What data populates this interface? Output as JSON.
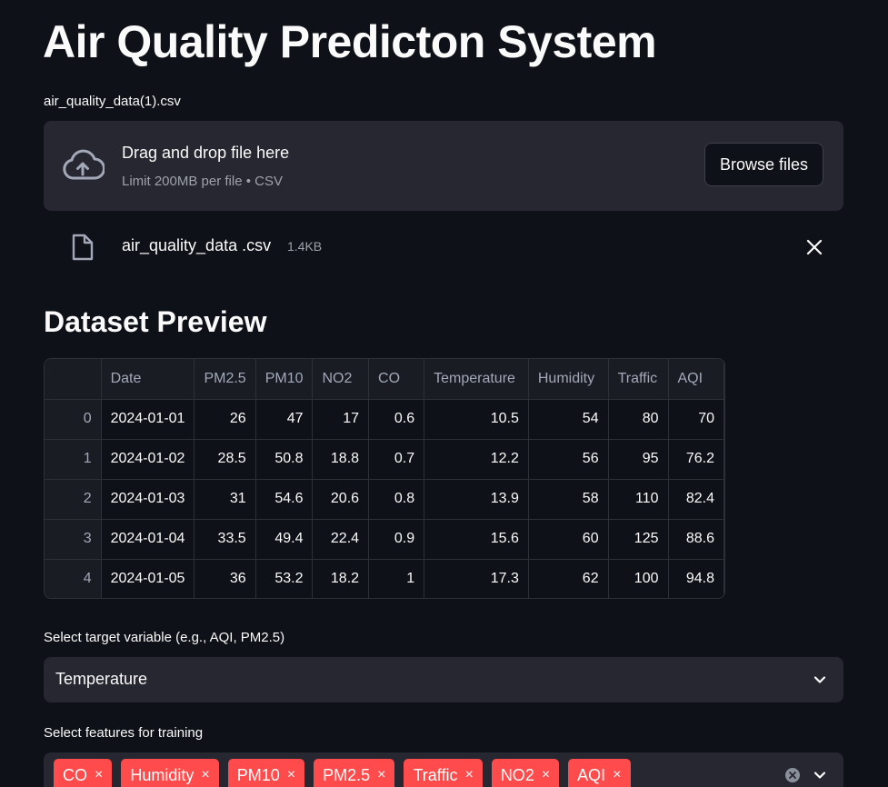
{
  "app": {
    "title": "Air Quality Predicton System"
  },
  "uploader": {
    "label": "air_quality_data(1).csv",
    "drop_text": "Drag and drop file here",
    "limit_text": "Limit 200MB per file • CSV",
    "browse_label": "Browse files",
    "icon": "cloud-upload-icon"
  },
  "uploaded_file": {
    "name": "air_quality_data .csv",
    "size": "1.4KB",
    "icon": "file-icon",
    "remove_icon": "close-icon"
  },
  "preview": {
    "heading": "Dataset Preview",
    "columns": [
      "",
      "Date",
      "PM2.5",
      "PM10",
      "NO2",
      "CO",
      "Temperature",
      "Humidity",
      "Traffic",
      "AQI"
    ],
    "rows": [
      [
        "0",
        "2024-01-01",
        "26",
        "47",
        "17",
        "0.6",
        "10.5",
        "54",
        "80",
        "70"
      ],
      [
        "1",
        "2024-01-02",
        "28.5",
        "50.8",
        "18.8",
        "0.7",
        "12.2",
        "56",
        "95",
        "76.2"
      ],
      [
        "2",
        "2024-01-03",
        "31",
        "54.6",
        "20.6",
        "0.8",
        "13.9",
        "58",
        "110",
        "82.4"
      ],
      [
        "3",
        "2024-01-04",
        "33.5",
        "49.4",
        "22.4",
        "0.9",
        "15.6",
        "60",
        "125",
        "88.6"
      ],
      [
        "4",
        "2024-01-05",
        "36",
        "53.2",
        "18.2",
        "1",
        "17.3",
        "62",
        "100",
        "94.8"
      ]
    ]
  },
  "target_select": {
    "label": "Select target variable (e.g., AQI, PM2.5)",
    "value": "Temperature"
  },
  "features_select": {
    "label": "Select features for training",
    "tags": [
      "CO",
      "Humidity",
      "PM10",
      "PM2.5",
      "Traffic",
      "NO2",
      "AQI"
    ],
    "tag_remove_glyph": "×"
  },
  "colors": {
    "background": "#0e1117",
    "surface": "#262730",
    "accent": "#ff4b4b",
    "muted_text": "#9da2ab"
  }
}
